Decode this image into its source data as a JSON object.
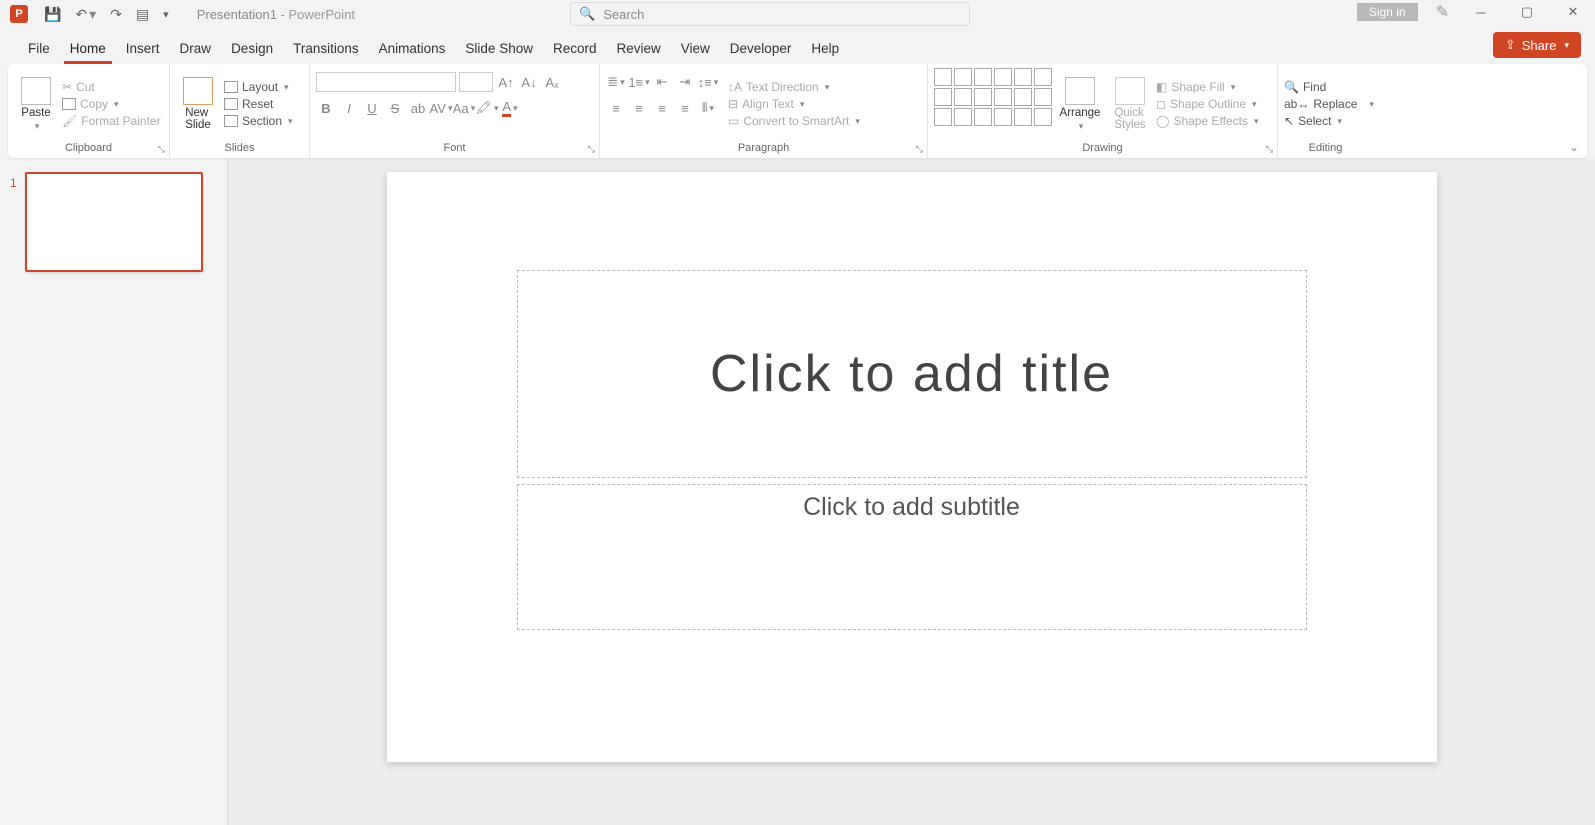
{
  "app": {
    "letter": "P",
    "doc_name": "Presentation1",
    "app_suffix": " - PowerPoint",
    "signin": "Sign in",
    "search_placeholder": "Search"
  },
  "tabs": {
    "file": "File",
    "home": "Home",
    "insert": "Insert",
    "draw": "Draw",
    "design": "Design",
    "transitions": "Transitions",
    "animations": "Animations",
    "slideshow": "Slide Show",
    "record": "Record",
    "review": "Review",
    "view": "View",
    "developer": "Developer",
    "help": "Help",
    "share": "Share"
  },
  "ribbon": {
    "clipboard": {
      "label": "Clipboard",
      "paste": "Paste",
      "cut": "Cut",
      "copy": "Copy",
      "format_painter": "Format Painter"
    },
    "slides": {
      "label": "Slides",
      "new_slide": "New\nSlide",
      "layout": "Layout",
      "reset": "Reset",
      "section": "Section"
    },
    "font": {
      "label": "Font"
    },
    "paragraph": {
      "label": "Paragraph",
      "text_direction": "Text Direction",
      "align_text": "Align Text",
      "convert_smartart": "Convert to SmartArt"
    },
    "drawing": {
      "label": "Drawing",
      "arrange": "Arrange",
      "quick_styles": "Quick\nStyles",
      "shape_fill": "Shape Fill",
      "shape_outline": "Shape Outline",
      "shape_effects": "Shape Effects"
    },
    "editing": {
      "label": "Editing",
      "find": "Find",
      "replace": "Replace",
      "select": "Select"
    }
  },
  "slidepanel": {
    "num1": "1"
  },
  "canvas": {
    "title_placeholder": "Click to add title",
    "subtitle_placeholder": "Click to add subtitle"
  }
}
